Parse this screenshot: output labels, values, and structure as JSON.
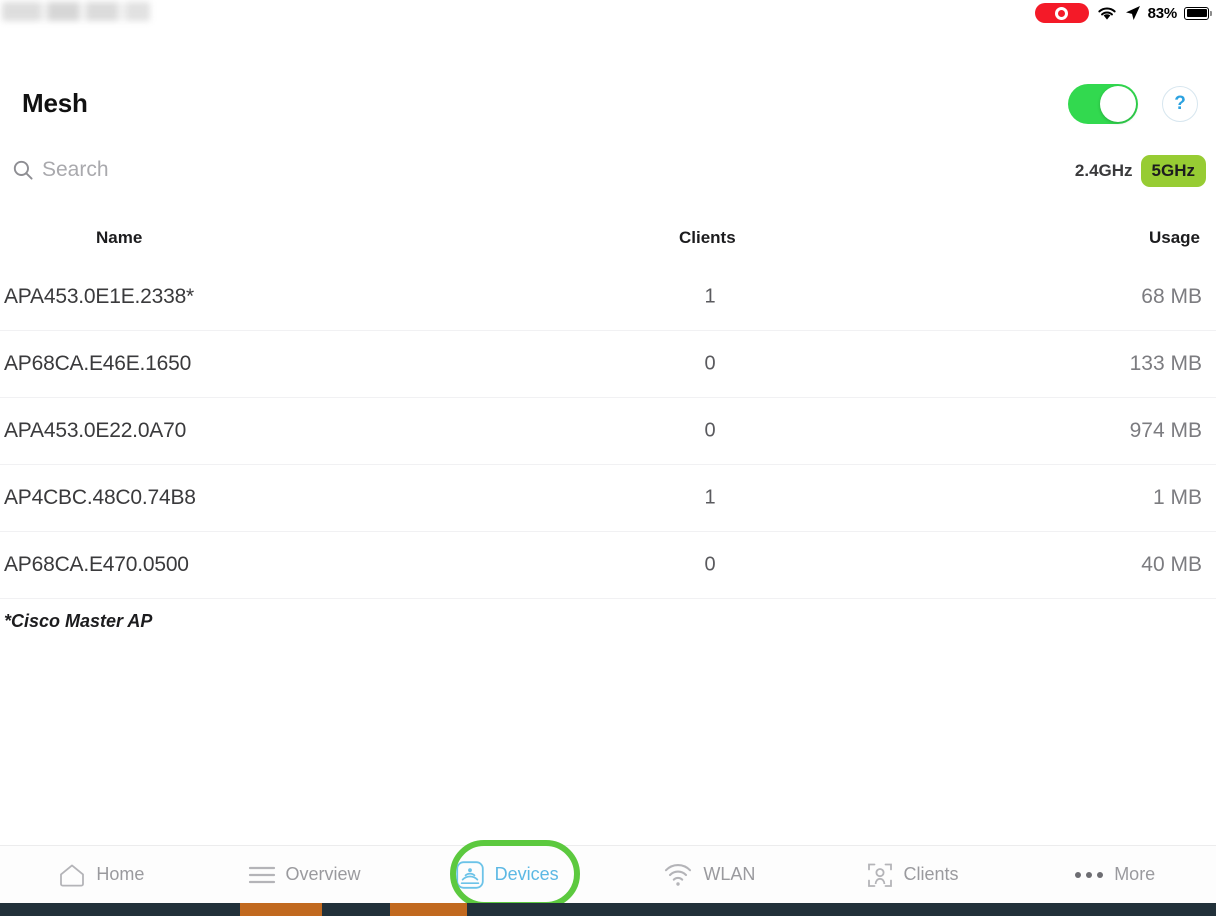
{
  "status_bar": {
    "recording_icon": "record-indicator",
    "wifi_icon": "wifi-icon",
    "location_icon": "location-arrow-icon",
    "battery_percent": "83%",
    "battery_icon": "battery-icon"
  },
  "header": {
    "title": "Mesh",
    "toggle": {
      "name": "mesh-toggle",
      "state": "on",
      "color": "#32d94f"
    },
    "help_label": "?"
  },
  "search": {
    "placeholder": "Search",
    "icon": "search-icon",
    "value": ""
  },
  "band_selector": {
    "options": [
      {
        "label": "2.4GHz",
        "selected": false
      },
      {
        "label": "5GHz",
        "selected": true
      }
    ],
    "selected_color": "#97cc33"
  },
  "table": {
    "columns": [
      "Name",
      "Clients",
      "Usage"
    ],
    "rows": [
      {
        "name": "APA453.0E1E.2338*",
        "clients": "1",
        "usage": "68 MB"
      },
      {
        "name": "AP68CA.E46E.1650",
        "clients": "0",
        "usage": "133 MB"
      },
      {
        "name": "APA453.0E22.0A70",
        "clients": "0",
        "usage": "974 MB"
      },
      {
        "name": "AP4CBC.48C0.74B8",
        "clients": "1",
        "usage": "1 MB"
      },
      {
        "name": "AP68CA.E470.0500",
        "clients": "0",
        "usage": "40 MB"
      }
    ],
    "footnote": "*Cisco Master AP"
  },
  "tabbar": {
    "items": [
      {
        "label": "Home",
        "icon": "home-icon",
        "active": false
      },
      {
        "label": "Overview",
        "icon": "list-icon",
        "active": false
      },
      {
        "label": "Devices",
        "icon": "access-point-icon",
        "active": true
      },
      {
        "label": "WLAN",
        "icon": "wifi-icon",
        "active": false
      },
      {
        "label": "Clients",
        "icon": "client-user-icon",
        "active": false
      },
      {
        "label": "More",
        "icon": "ellipsis-icon",
        "active": false
      }
    ],
    "active_color": "#5cb8e4",
    "highlight_color": "#5cc93f"
  }
}
